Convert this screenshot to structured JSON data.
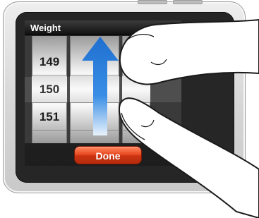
{
  "screen": {
    "title": "Weight",
    "status_icon": "battery-icon"
  },
  "picker": {
    "columns": [
      {
        "values": [
          "149",
          "150",
          "151"
        ],
        "selected": "150"
      },
      {
        "values": [
          "",
          "",
          ""
        ]
      },
      {
        "values": [
          "",
          "",
          ""
        ]
      }
    ]
  },
  "actions": {
    "done_label": "Done"
  },
  "gesture": {
    "type": "swipe-up",
    "arrow_icon": "up-arrow-icon",
    "hand_icon": "finger-icon"
  },
  "colors": {
    "done_button": "#e0461e",
    "arrow": "#2a7fd8",
    "bezel": "#262626"
  }
}
